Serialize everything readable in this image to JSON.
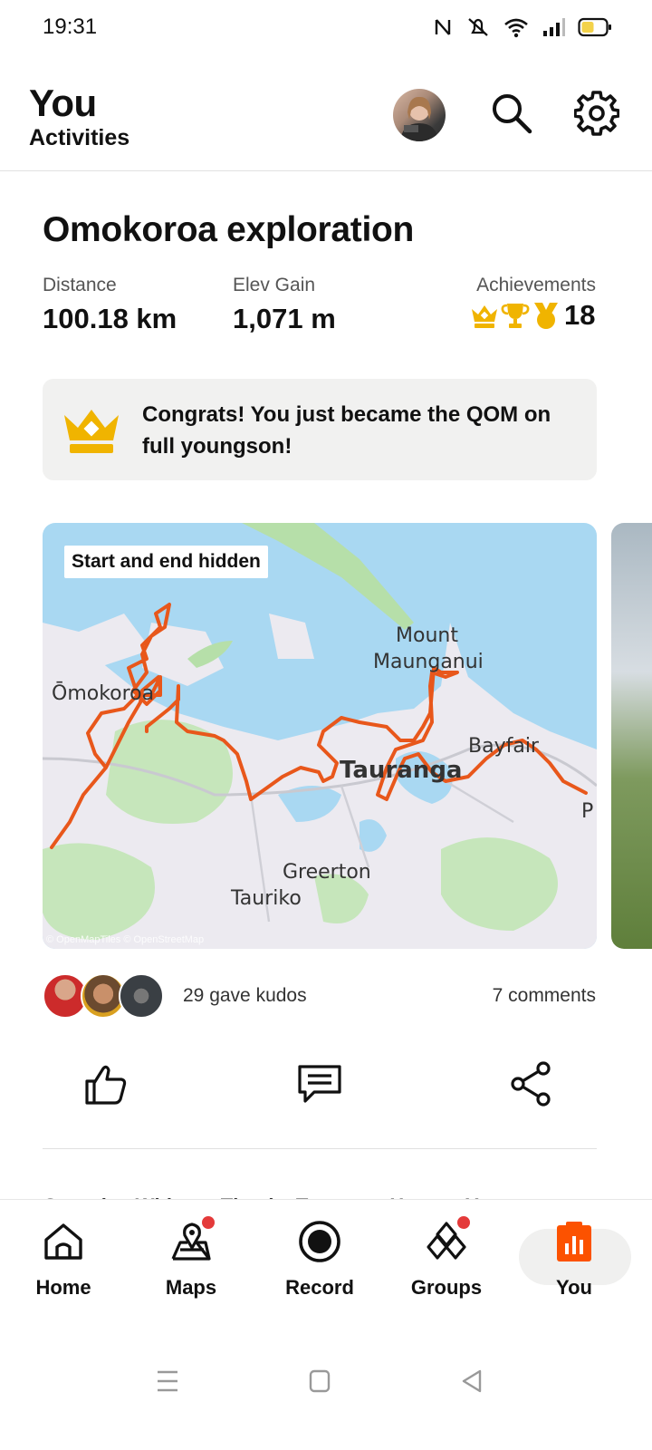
{
  "status": {
    "time": "19:31"
  },
  "header": {
    "title": "You",
    "subtitle": "Activities"
  },
  "activity": {
    "title": "Omokoroa exploration",
    "stats": [
      {
        "label": "Distance",
        "value": "100.18 km"
      },
      {
        "label": "Elev Gain",
        "value": "1,071 m"
      }
    ],
    "achievements": {
      "label": "Achievements",
      "count": "18"
    },
    "banner": "Congrats! You just became the QOM on full youngson!",
    "map": {
      "pill": "Start and end hidden",
      "places": {
        "mount": "Mount",
        "maunganui": "Maunganui",
        "omokoroa": "Ōmokoroa",
        "tauranga": "Tauranga",
        "bayfair": "Bayfair",
        "greerton": "Greerton",
        "tauriko": "Tauriko",
        "p": "P"
      },
      "attribution": "© OpenMapTiles © OpenStreetMap"
    },
    "kudos": "29 gave kudos",
    "comments": "7 comments",
    "next_item_peek": "Georgina White — Thanks Tauranga Harvey, Y"
  },
  "nav": {
    "items": [
      {
        "label": "Home",
        "icon": "home-icon"
      },
      {
        "label": "Maps",
        "icon": "maps-icon",
        "badge": true
      },
      {
        "label": "Record",
        "icon": "record-icon"
      },
      {
        "label": "Groups",
        "icon": "groups-icon",
        "badge": true
      },
      {
        "label": "You",
        "icon": "you-icon",
        "active": true
      }
    ]
  },
  "colors": {
    "accent": "#fc5200",
    "gold": "#f0b400",
    "route": "#e8571b",
    "water": "#a9d8f2"
  }
}
